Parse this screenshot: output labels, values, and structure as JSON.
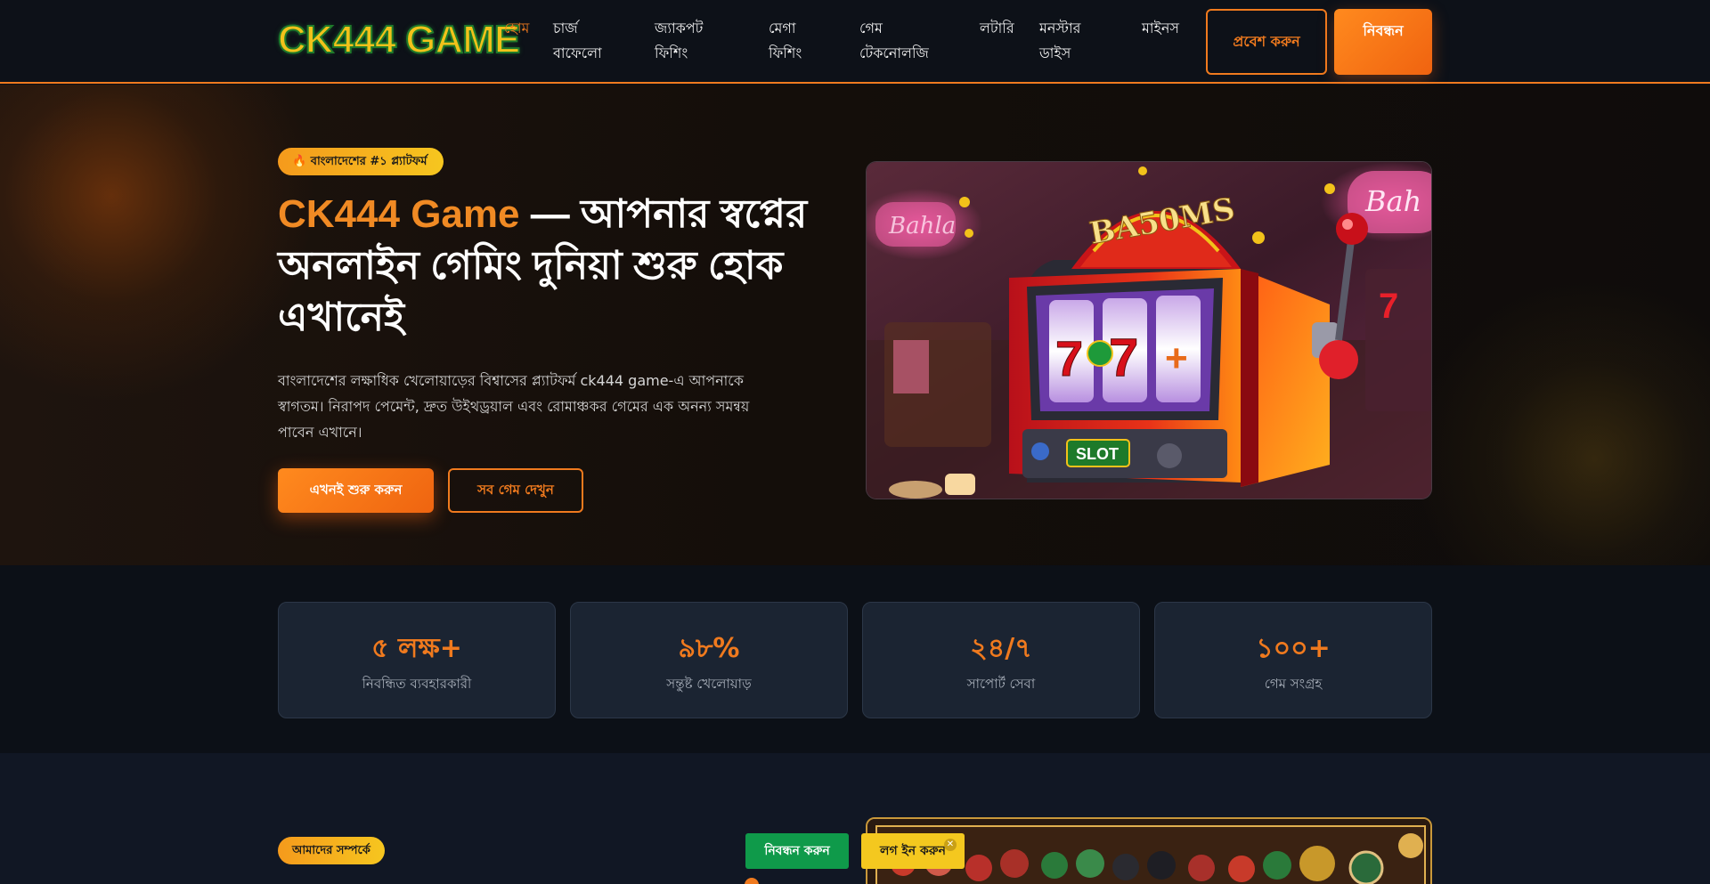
{
  "header": {
    "logo": "CK444 GAME",
    "nav": [
      {
        "label": "হোম",
        "active": true
      },
      {
        "label": "চার্জ বাফেলো",
        "active": false
      },
      {
        "label": "জ্যাকপট ফিশিং",
        "active": false
      },
      {
        "label": "মেগা ফিশিং",
        "active": false
      },
      {
        "label": "গেম টেকনোলজি",
        "active": false
      },
      {
        "label": "লটারি",
        "active": false
      },
      {
        "label": "মনস্টার ডাইস",
        "active": false
      },
      {
        "label": "মাইনস",
        "active": false
      }
    ],
    "login_label": "প্রবেশ করুন",
    "register_label": "নিবন্ধন"
  },
  "hero": {
    "badge": "🔥 বাংলাদেশের #১ প্ল্যাটফর্ম",
    "title_brand": "CK444 Game",
    "title_rest": " — আপনার স্বপ্নের অনলাইন গেমিং দুনিয়া শুরু হোক এখানেই",
    "description": "বাংলাদেশের লক্ষাধিক খেলোয়াড়ের বিশ্বাসের প্ল্যাটফর্ম ck444 game-এ আপনাকে স্বাগতম। নিরাপদ পেমেন্ট, দ্রুত উইথড্রয়াল এবং রোমাঞ্চকর গেমের এক অনন্য সমন্বয় পাবেন এখানে।",
    "cta_primary": "এখনই শুরু করুন",
    "cta_secondary": "সব গেম দেখুন",
    "image": {
      "marquee": "BA50MS",
      "panel": "SLOT",
      "sign_left": "Bahla",
      "sign_right": "Bah"
    }
  },
  "stats": [
    {
      "value": "৫ লক্ষ+",
      "label": "নিবন্ধিত ব্যবহারকারী"
    },
    {
      "value": "৯৮%",
      "label": "সন্তুষ্ট খেলোয়াড়"
    },
    {
      "value": "২৪/৭",
      "label": "সাপোর্ট সেবা"
    },
    {
      "value": "১০০+",
      "label": "গেম সংগ্রহ"
    }
  ],
  "about": {
    "badge": "আমাদের সম্পর্কে"
  },
  "floating": {
    "register_label": "নিবন্ধন করুন",
    "login_label": "লগ ইন করুন",
    "close_symbol": "✕"
  },
  "colors": {
    "accent": "#f07a1e",
    "background": "#0b0f17",
    "card": "#1b2432",
    "green": "#0f9a4a",
    "yellow": "#f4c81f"
  }
}
